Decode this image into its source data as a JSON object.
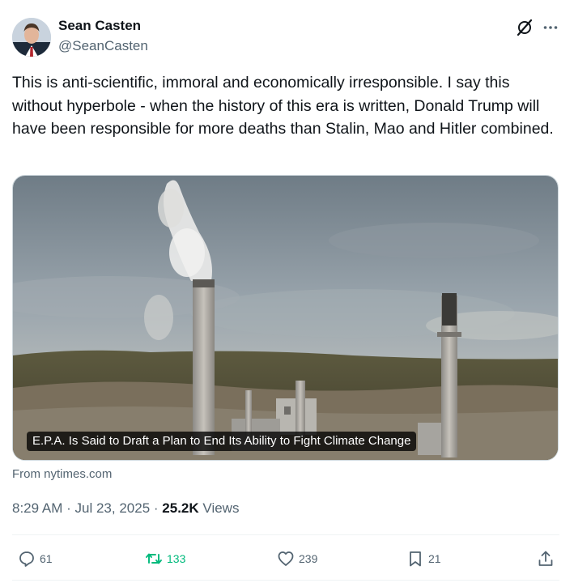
{
  "author": {
    "name": "Sean Casten",
    "handle": "@SeanCasten"
  },
  "tweet": {
    "text": "This is anti-scientific, immoral and economically irresponsible.  I say this without hyperbole - when the history of this era is written, Donald Trump will have been responsible for more deaths than Stalin, Mao and Hitler combined."
  },
  "card": {
    "headline": "E.P.A. Is Said to Draft a Plan to End Its Ability to Fight Climate Change",
    "source": "From nytimes.com"
  },
  "meta": {
    "time": "8:29 AM",
    "separator": "·",
    "date": "Jul 23, 2025",
    "views_count": "25.2K",
    "views_label": "Views"
  },
  "actions": {
    "replies": "61",
    "reposts": "133",
    "likes": "239",
    "bookmarks": "21"
  },
  "colors": {
    "text": "#0f1419",
    "secondary": "#536471",
    "repost_active": "#00ba7c",
    "divider": "#eff3f4"
  },
  "icons": [
    "grok-icon",
    "more-icon",
    "reply-icon",
    "repost-icon",
    "like-icon",
    "bookmark-icon",
    "share-icon"
  ]
}
